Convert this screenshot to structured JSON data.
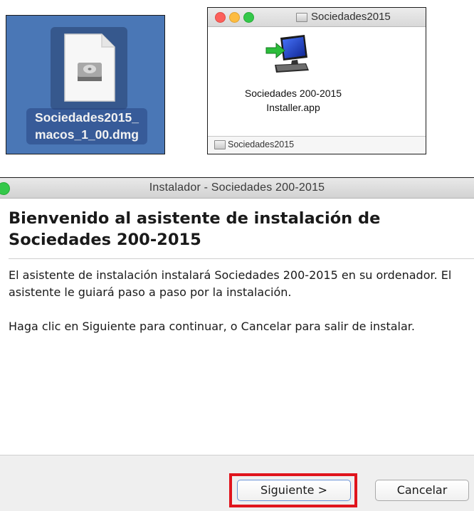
{
  "dmg": {
    "filename_line1": "Sociedades2015_",
    "filename_line2": "macos_1_00.dmg",
    "icon": "disk-image-icon"
  },
  "finder": {
    "title": "Sociedades2015",
    "app_label_line1": "Sociedades 200-2015",
    "app_label_line2": "Installer.app",
    "status_path": "Sociedades2015",
    "icons": [
      "drive-icon",
      "installer-app-icon"
    ]
  },
  "installer": {
    "title": "Instalador - Sociedades 200-2015",
    "heading_line1": "Bienvenido al asistente de instalación de",
    "heading_line2": "Sociedades 200-2015",
    "paragraph1": "El asistente de instalación instalará Sociedades 200-2015 en su ordenador. El asistente le guiará paso a paso por la instalación.",
    "paragraph2": "Haga clic en Siguiente para continuar, o Cancelar para salir de instalar.",
    "next_label": "Siguiente >",
    "cancel_label": "Cancelar",
    "highlight_color": "#e0141c"
  }
}
